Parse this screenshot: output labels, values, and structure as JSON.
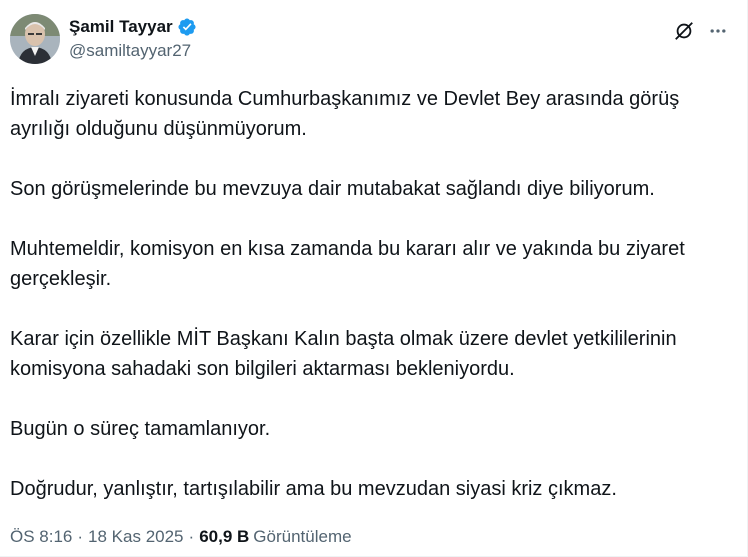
{
  "author": {
    "display_name": "Şamil Tayyar",
    "handle": "@samiltayyar27",
    "verified": true,
    "verified_color": "#1d9bf0"
  },
  "actions": {
    "grok_icon": "slashed-circle-icon",
    "more_icon": "more-horizontal-icon"
  },
  "tweet": {
    "paragraphs": [
      "İmralı ziyareti konusunda Cumhurbaşkanımız ve Devlet Bey arasında görüş ayrılığı olduğunu düşünmüyorum.",
      "Son görüşmelerinde bu mevzuya dair mutabakat sağlandı diye biliyorum.",
      "Muhtemeldir, komisyon en kısa zamanda bu kararı alır ve yakında bu ziyaret gerçekleşir.",
      "Karar için özellikle MİT Başkanı Kalın başta olmak üzere devlet yetkililerinin komisyona sahadaki son bilgileri aktarması bekleniyordu.",
      "Bugün o süreç tamamlanıyor.",
      "Doğrudur, yanlıştır, tartışılabilir ama bu mevzudan siyasi kriz çıkmaz."
    ]
  },
  "meta": {
    "time": "ÖS 8:16",
    "separator": "·",
    "date": "18 Kas 2025",
    "views_count": "60,9 B",
    "views_label": "Görüntüleme"
  },
  "colors": {
    "text_primary": "#0f1419",
    "text_secondary": "#536471",
    "border": "#eff3f4"
  }
}
